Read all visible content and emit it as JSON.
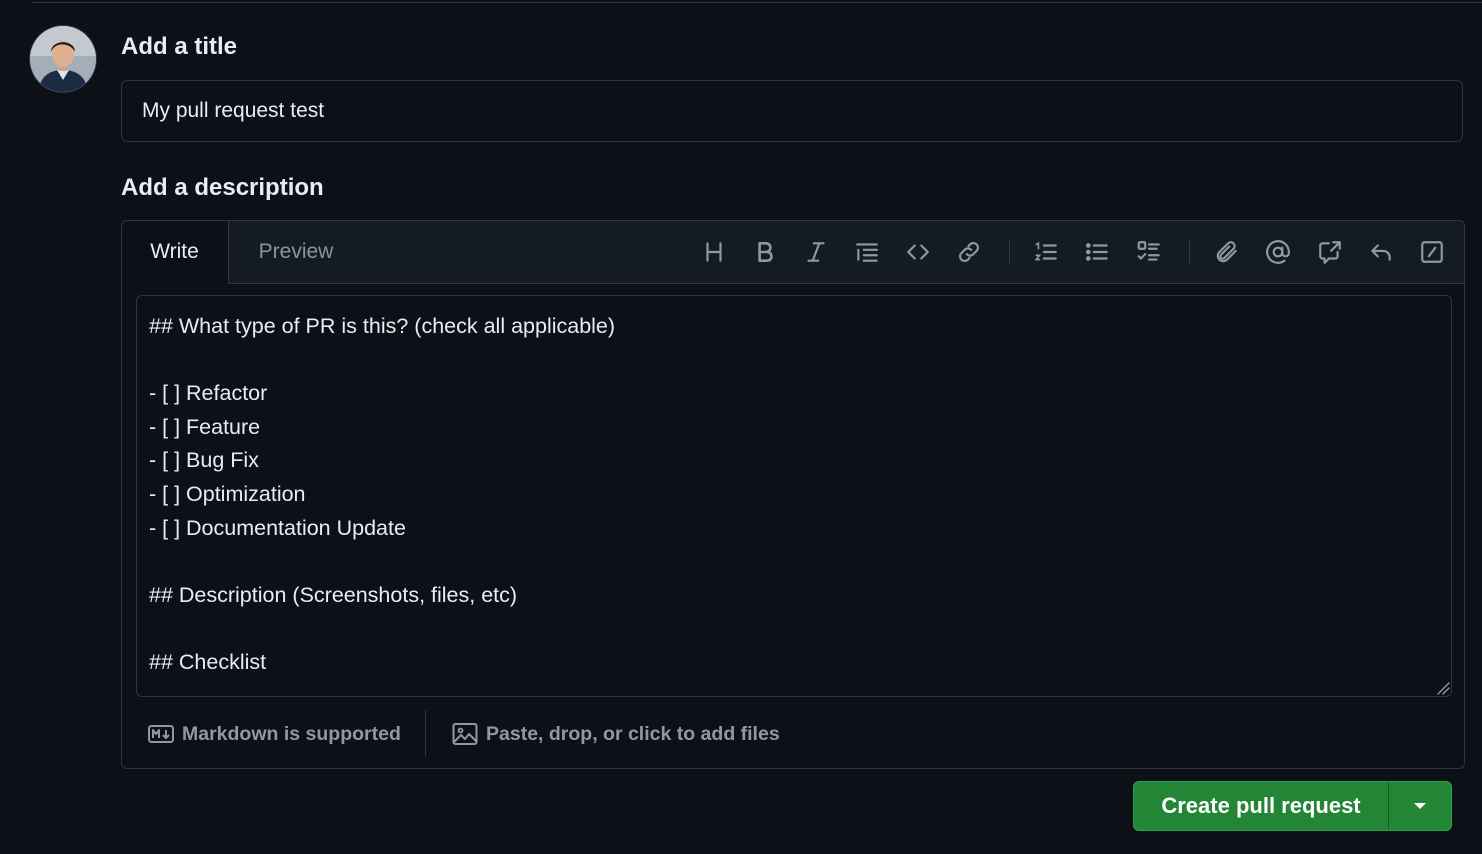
{
  "title_section": {
    "label": "Add a title",
    "value": "My pull request test"
  },
  "description_section": {
    "label": "Add a description",
    "tabs": {
      "write": "Write",
      "preview": "Preview"
    },
    "active_tab": "Write",
    "toolbar_icons": [
      "heading-icon",
      "bold-icon",
      "italic-icon",
      "quote-icon",
      "code-icon",
      "link-icon",
      "ordered-list-icon",
      "unordered-list-icon",
      "task-list-icon",
      "attach-icon",
      "mention-icon",
      "cross-reference-icon",
      "undo-icon",
      "slash-commands-icon"
    ],
    "body": "## What type of PR is this? (check all applicable)\n\n- [ ] Refactor\n- [ ] Feature\n- [ ] Bug Fix\n- [ ] Optimization\n- [ ] Documentation Update\n\n## Description (Screenshots, files, etc)\n\n## Checklist",
    "footer": {
      "markdown_note": "Markdown is supported",
      "attach_note": "Paste, drop, or click to add files"
    }
  },
  "actions": {
    "create_label": "Create pull request"
  },
  "colors": {
    "background": "#0d1117",
    "border": "#30363d",
    "primary_button": "#238636",
    "muted_text": "#9198a1"
  }
}
